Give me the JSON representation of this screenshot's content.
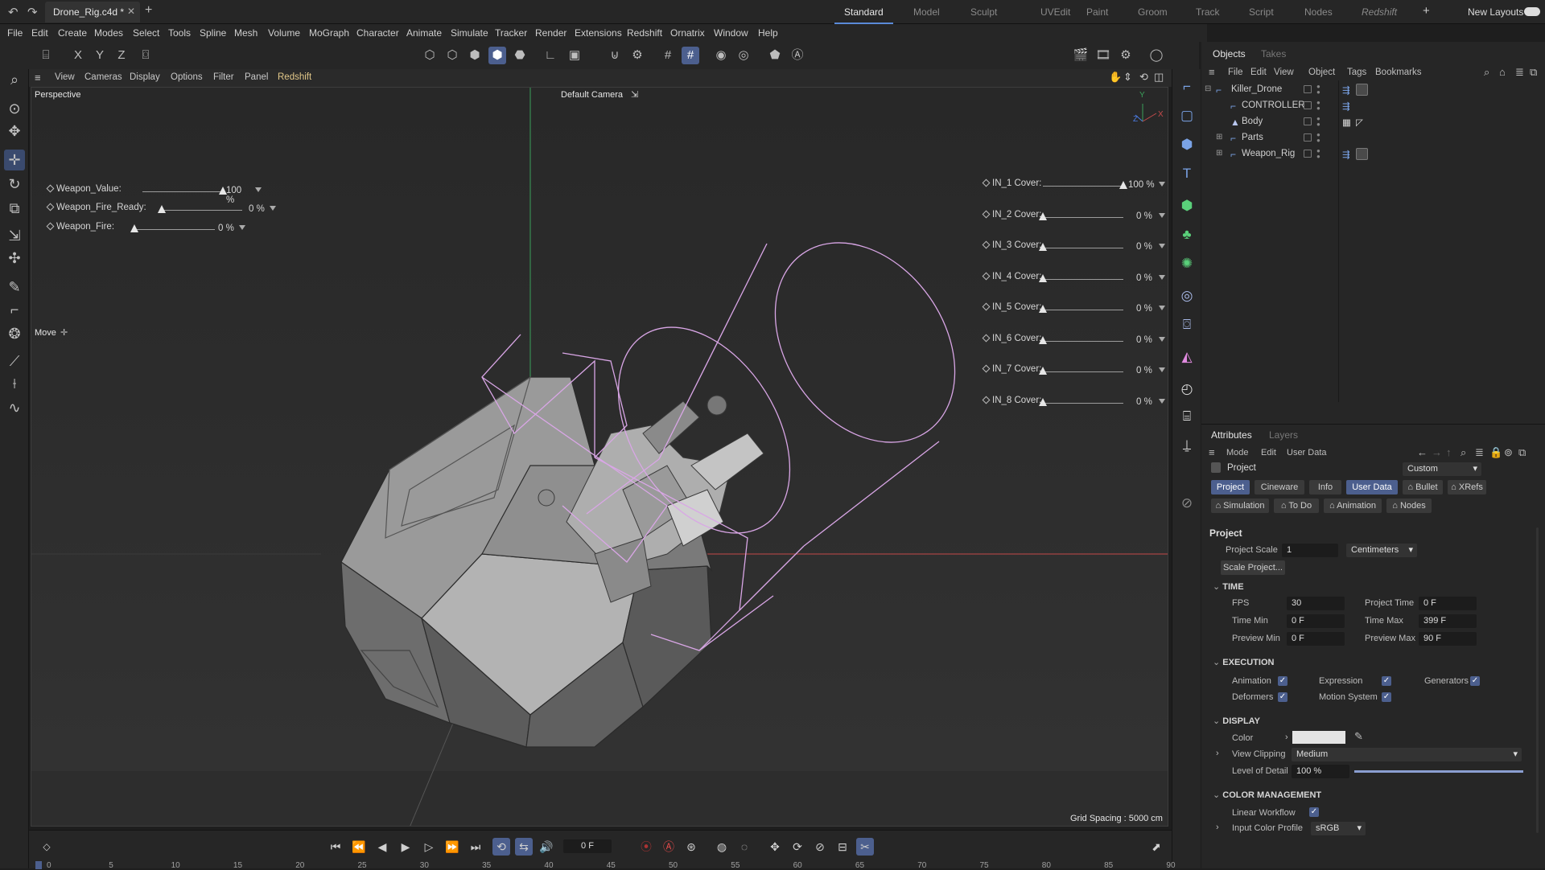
{
  "document": {
    "tab_label": "Drone_Rig.c4d *"
  },
  "layouts": [
    "Standard",
    "Model",
    "Sculpt",
    "UVEdit",
    "Paint",
    "Groom",
    "Track",
    "Script",
    "Nodes",
    "Redshift"
  ],
  "layout_active": "Standard",
  "new_layouts_label": "New Layouts",
  "menubar": [
    "File",
    "Edit",
    "Create",
    "Modes",
    "Select",
    "Tools",
    "Spline",
    "Mesh",
    "Volume",
    "MoGraph",
    "Character",
    "Animate",
    "Simulate",
    "Tracker",
    "Render",
    "Extensions",
    "Redshift",
    "Ornatrix",
    "Window",
    "Help"
  ],
  "viewport": {
    "menu": [
      "View",
      "Cameras",
      "Display",
      "Options",
      "Filter",
      "Panel",
      "Redshift"
    ],
    "view_name": "Perspective",
    "camera_label": "Default Camera",
    "tool_label": "Move",
    "grid_spacing": "Grid Spacing : 5000 cm",
    "axis_labels": {
      "y": "Y",
      "x": "X",
      "z": "Z"
    },
    "left_sliders": [
      {
        "label": "Weapon_Value:",
        "value_text": "100 %",
        "fraction": 1.0
      },
      {
        "label": "Weapon_Fire_Ready:",
        "value_text": "0 %",
        "fraction": 0.0
      },
      {
        "label": "Weapon_Fire:",
        "value_text": "0 %",
        "fraction": 0.0
      }
    ],
    "right_sliders": [
      {
        "label": "IN_1 Cover:",
        "value_text": "100 %",
        "fraction": 1.0
      },
      {
        "label": "IN_2 Cover:",
        "value_text": "0 %",
        "fraction": 0.0
      },
      {
        "label": "IN_3 Cover:",
        "value_text": "0 %",
        "fraction": 0.0
      },
      {
        "label": "IN_4 Cover:",
        "value_text": "0 %",
        "fraction": 0.0
      },
      {
        "label": "IN_5 Cover:",
        "value_text": "0 %",
        "fraction": 0.0
      },
      {
        "label": "IN_6 Cover:",
        "value_text": "0 %",
        "fraction": 0.0
      },
      {
        "label": "IN_7 Cover:",
        "value_text": "0 %",
        "fraction": 0.0
      },
      {
        "label": "IN_8 Cover:",
        "value_text": "0 %",
        "fraction": 0.0
      }
    ]
  },
  "objects_panel": {
    "tabs": [
      "Objects",
      "Takes"
    ],
    "menu": [
      "File",
      "Edit",
      "View",
      "Object",
      "Tags",
      "Bookmarks"
    ],
    "items": [
      {
        "name": "Killer_Drone"
      },
      {
        "name": "CONTROLLER"
      },
      {
        "name": "Body"
      },
      {
        "name": "Parts"
      },
      {
        "name": "Weapon_Rig"
      }
    ]
  },
  "attributes": {
    "tabs": [
      "Attributes",
      "Layers"
    ],
    "menu": [
      "Mode",
      "Edit",
      "User Data"
    ],
    "object_label": "Project",
    "preset": "Custom",
    "subtabs_row1": [
      "Project",
      "Cineware",
      "Info",
      "User Data",
      "Bullet",
      "XRefs"
    ],
    "subtabs_row2": [
      "Simulation",
      "To Do",
      "Animation",
      "Nodes"
    ],
    "section_title": "Project",
    "project_scale_label": "Project Scale",
    "project_scale_value": "1",
    "project_scale_unit": "Centimeters",
    "scale_project_button": "Scale Project...",
    "time": {
      "title": "TIME",
      "fps_label": "FPS",
      "fps": "30",
      "project_time_label": "Project Time",
      "project_time": "0 F",
      "time_min_label": "Time Min",
      "time_min": "0 F",
      "time_max_label": "Time Max",
      "time_max": "399 F",
      "preview_min_label": "Preview Min",
      "preview_min": "0 F",
      "preview_max_label": "Preview Max",
      "preview_max": "90 F"
    },
    "execution": {
      "title": "EXECUTION",
      "animation": "Animation",
      "expression": "Expression",
      "generators": "Generators",
      "deformers": "Deformers",
      "motion_system": "Motion System"
    },
    "display": {
      "title": "DISPLAY",
      "color_label": "Color",
      "view_clipping_label": "View Clipping",
      "view_clipping": "Medium",
      "lod_label": "Level of Detail",
      "lod": "100 %",
      "lod_fraction": 1.0
    },
    "color_management": {
      "title": "COLOR MANAGEMENT",
      "linear_workflow": "Linear Workflow",
      "input_profile_label": "Input Color Profile",
      "input_profile": "sRGB"
    }
  },
  "timeline": {
    "current_frame": "0 F",
    "ruler": [
      "0",
      "5",
      "10",
      "15",
      "20",
      "25",
      "30",
      "35",
      "40",
      "45",
      "50",
      "55",
      "60",
      "65",
      "70",
      "75",
      "80",
      "85",
      "90"
    ]
  },
  "colors": {
    "accent": "#4c5f8e",
    "wire": "#d9a6e6",
    "x_axis": "#c44a4a",
    "y_axis": "#3aa05a"
  }
}
